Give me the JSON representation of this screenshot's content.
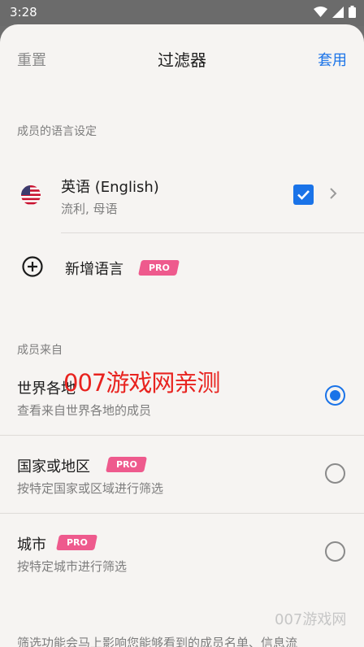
{
  "status": {
    "time": "3:28"
  },
  "header": {
    "reset": "重置",
    "title": "过滤器",
    "apply": "套用"
  },
  "languages": {
    "section_label": "成员的语言设定",
    "items": [
      {
        "name": "英语 (English)",
        "detail": "流利, 母语",
        "checked": true
      }
    ],
    "add_label": "新增语言",
    "add_badge": "PRO"
  },
  "origin": {
    "section_label": "成员来自",
    "options": [
      {
        "title": "世界各地",
        "subtitle": "查看来自世界各地的成员",
        "badge": "",
        "selected": true
      },
      {
        "title": "国家或地区",
        "subtitle": "按特定国家或区域进行筛选",
        "badge": "PRO",
        "selected": false
      },
      {
        "title": "城市",
        "subtitle": "按特定城市进行筛选",
        "badge": "PRO",
        "selected": false
      }
    ]
  },
  "footer_note": "筛选功能会马上影响您能够看到的成员名单、信息流",
  "watermark": {
    "main": "007游戏网亲测",
    "corner": "007游戏网"
  },
  "colors": {
    "accent": "#1a73e8",
    "pro": "#ee5a8d",
    "watermark": "#e8231f"
  }
}
